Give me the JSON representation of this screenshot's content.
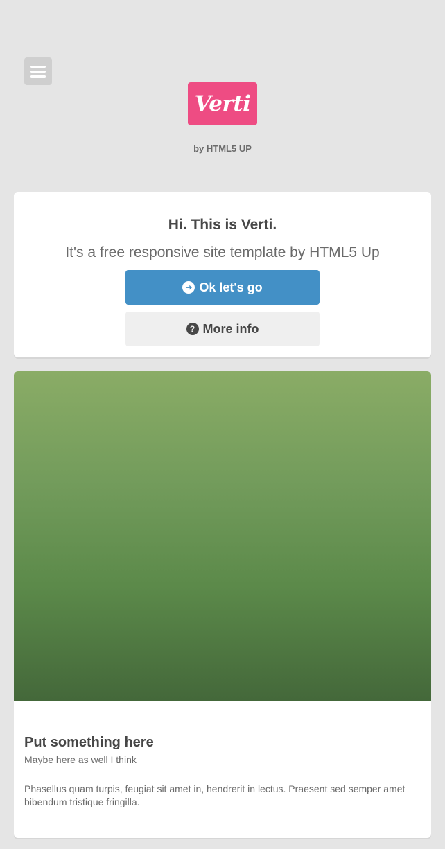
{
  "header": {
    "menu_icon": "hamburger-menu-icon",
    "logo_text": "Verti",
    "byline": "by HTML5 UP"
  },
  "banner": {
    "title": "Hi. This is Verti.",
    "subtitle": "It's a free responsive site template by HTML5 Up",
    "primary_button": {
      "label": "Ok let's go",
      "icon": "arrow-circle-right-icon"
    },
    "secondary_button": {
      "label": "More info",
      "icon": "question-circle-icon"
    }
  },
  "feature": {
    "title": "Put something here",
    "subtitle": "Maybe here as well I think",
    "body": "Phasellus quam turpis, feugiat sit amet in, hendrerit in lectus. Praesent sed semper amet bibendum tristique fringilla."
  },
  "colors": {
    "background": "#e5e5e5",
    "logo": "#ee4c83",
    "primary_button": "#4390c6",
    "secondary_button": "#efefef",
    "text": "#474747"
  }
}
